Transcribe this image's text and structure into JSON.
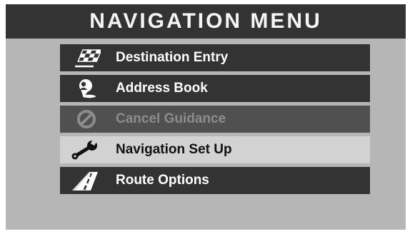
{
  "header": {
    "title": "NAVIGATION MENU"
  },
  "menu": {
    "items": [
      {
        "label": "Destination Entry",
        "icon": "checkered-flag-icon",
        "state": "normal"
      },
      {
        "label": "Address Book",
        "icon": "address-book-pin-icon",
        "state": "normal"
      },
      {
        "label": "Cancel Guidance",
        "icon": "cancel-icon",
        "state": "disabled"
      },
      {
        "label": "Navigation Set Up",
        "icon": "wrench-icon",
        "state": "selected"
      },
      {
        "label": "Route Options",
        "icon": "road-icon",
        "state": "normal"
      }
    ]
  },
  "colors": {
    "background": "#b6b6b6",
    "header_bar": "#333333",
    "item_normal": "#333333",
    "item_selected": "#d2d2d2",
    "item_disabled": "#505050",
    "text_normal": "#ffffff",
    "text_selected": "#111111",
    "text_disabled": "#8c8c8c"
  }
}
